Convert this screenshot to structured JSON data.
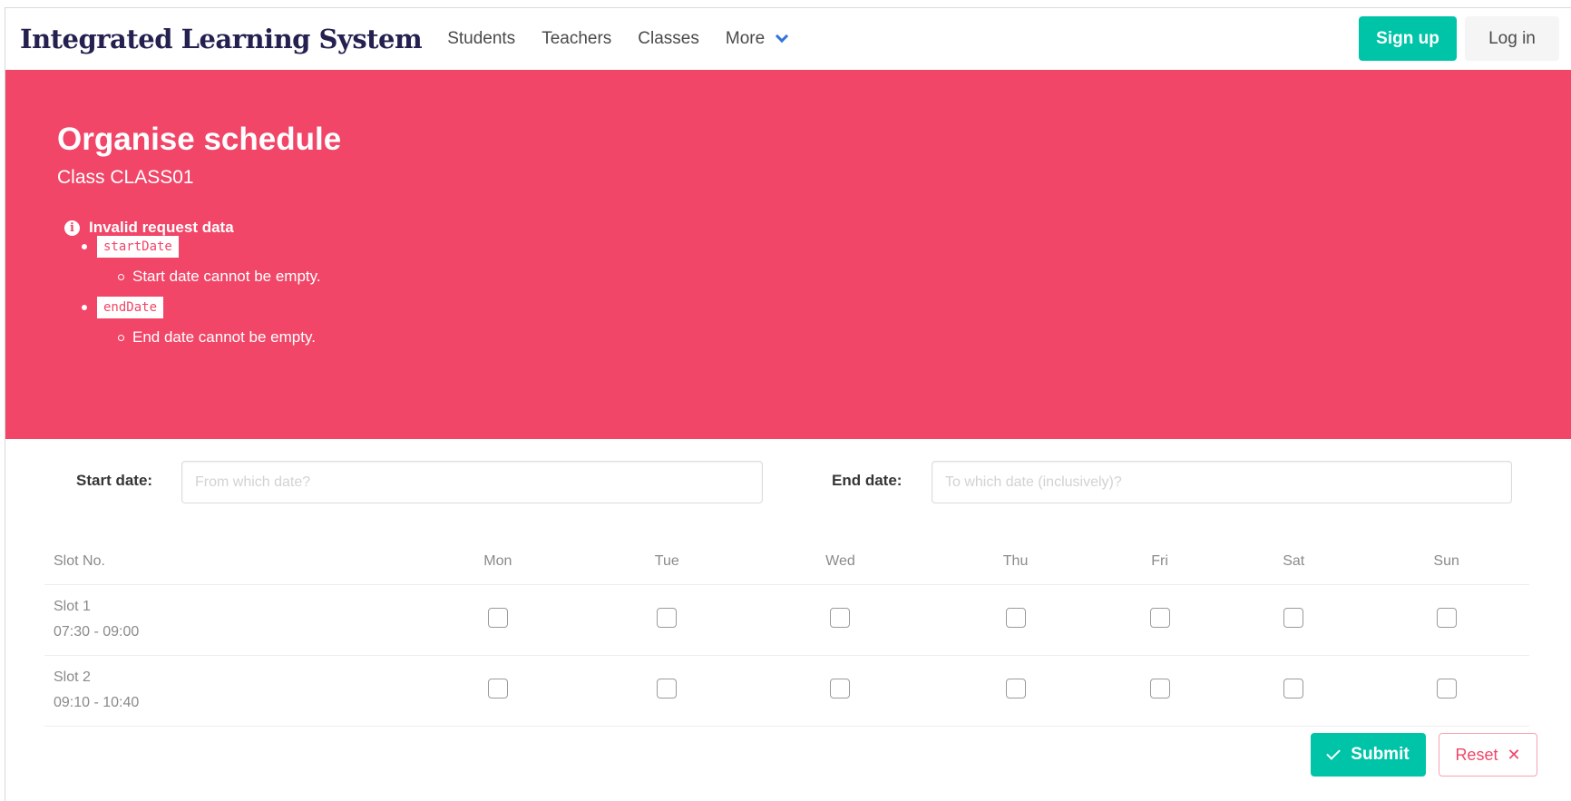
{
  "navbar": {
    "brand": "Integrated Learning System",
    "links": [
      "Students",
      "Teachers",
      "Classes",
      "More"
    ],
    "signup_label": "Sign up",
    "login_label": "Log in"
  },
  "hero": {
    "title": "Organise schedule",
    "subtitle": "Class CLASS01",
    "error_title": "Invalid request data",
    "errors": [
      {
        "field": "startDate",
        "message": "Start date cannot be empty."
      },
      {
        "field": "endDate",
        "message": "End date cannot be empty."
      }
    ]
  },
  "form": {
    "start_label": "Start date:",
    "start_placeholder": "From which date?",
    "end_label": "End date:",
    "end_placeholder": "To which date (inclusively)?"
  },
  "table": {
    "headers": [
      "Slot No.",
      "Mon",
      "Tue",
      "Wed",
      "Thu",
      "Fri",
      "Sat",
      "Sun"
    ],
    "rows": [
      {
        "slot": "Slot 1",
        "time": "07:30 - 09:00"
      },
      {
        "slot": "Slot 2",
        "time": "09:10 - 10:40"
      }
    ]
  },
  "actions": {
    "submit_label": "Submit",
    "reset_label": "Reset"
  },
  "colors": {
    "primary": "#00c4a7",
    "danger": "#f14668",
    "brand": "#242150",
    "link": "#3273dc"
  }
}
